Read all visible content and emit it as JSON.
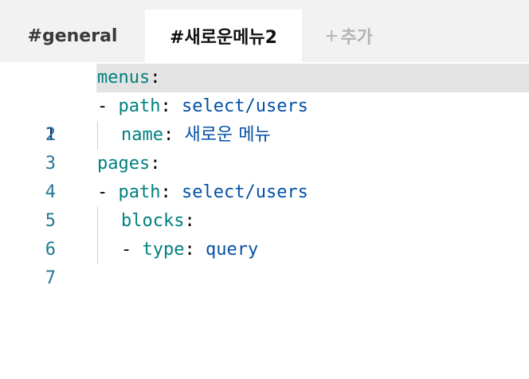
{
  "tabs": {
    "general": "#general",
    "active": "#새로운메뉴2",
    "add_plus": "+",
    "add_label": "추가"
  },
  "editor": {
    "current_line": 1,
    "lines": [
      {
        "num": "1",
        "dash": "",
        "key": "menus",
        "colon": ":",
        "value": ""
      },
      {
        "num": "2",
        "dash": "- ",
        "key": "path",
        "colon": ": ",
        "value": "select/users"
      },
      {
        "num": "3",
        "dash": "",
        "key": "name",
        "colon": ": ",
        "value": "새로운 메뉴"
      },
      {
        "num": "4",
        "dash": "",
        "key": "pages",
        "colon": ":",
        "value": ""
      },
      {
        "num": "5",
        "dash": "- ",
        "key": "path",
        "colon": ": ",
        "value": "select/users"
      },
      {
        "num": "6",
        "dash": "",
        "key": "blocks",
        "colon": ":",
        "value": ""
      },
      {
        "num": "7",
        "dash": "- ",
        "key": "type",
        "colon": ": ",
        "value": "query"
      }
    ]
  },
  "colors": {
    "key": "#008080",
    "value": "#0451a5",
    "line_number": "#237893",
    "current_line_bg": "#e3e3e3",
    "tabbar_bg": "#f2f2f2"
  }
}
